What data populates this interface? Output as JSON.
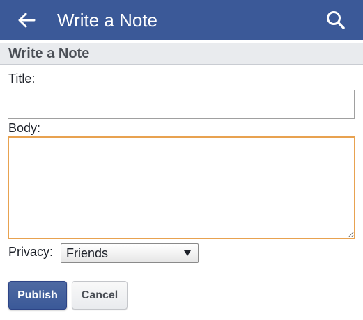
{
  "appbar": {
    "back_icon": "arrow-left-icon",
    "title": "Write a Note",
    "search_icon": "search-icon",
    "background_color": "#3b5998"
  },
  "section": {
    "title": "Write a Note"
  },
  "form": {
    "title_label": "Title:",
    "title_value": "",
    "body_label": "Body:",
    "body_value": "",
    "privacy_label": "Privacy:",
    "privacy_selected": "Friends",
    "body_focus_color": "#e8a250"
  },
  "actions": {
    "publish_label": "Publish",
    "cancel_label": "Cancel"
  }
}
